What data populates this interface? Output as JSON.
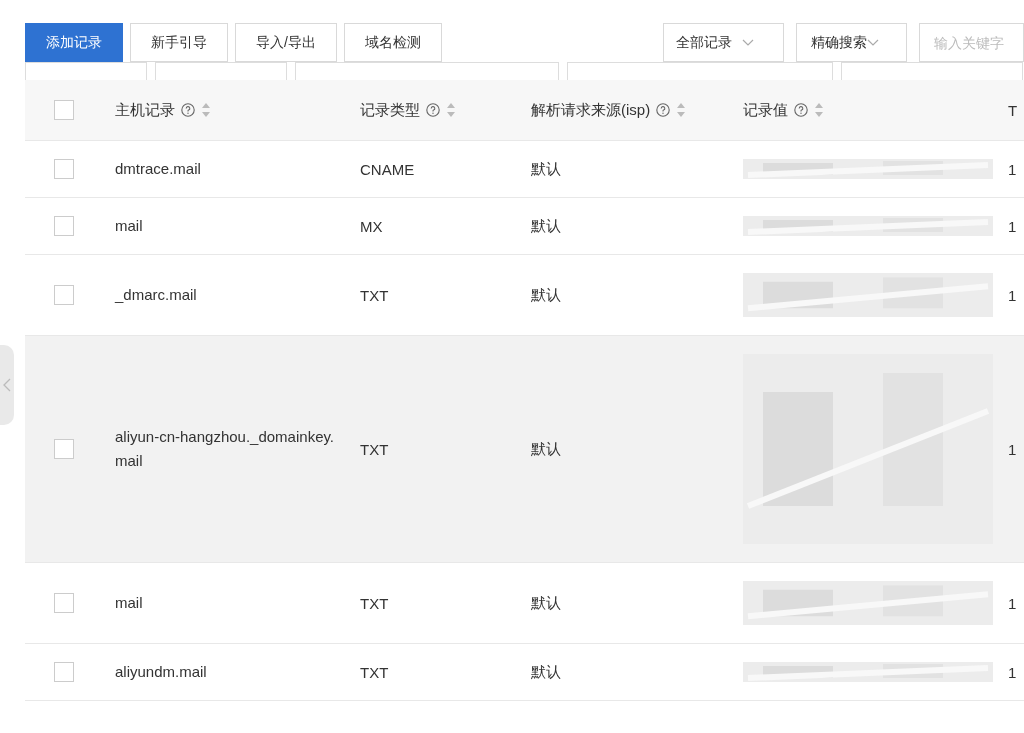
{
  "toolbar": {
    "primary_button": "添加记录",
    "buttons": [
      "新手引导",
      "导入/导出",
      "域名检测"
    ],
    "filter_dropdown": "全部记录",
    "search_mode_dropdown": "精确搜索",
    "search": {
      "placeholder": "输入关键字"
    }
  },
  "table": {
    "select_all_checked": false,
    "columns": [
      "主机记录",
      "记录类型",
      "解析请求来源(isp)",
      "记录值"
    ],
    "column_5": "T",
    "rows": [
      {
        "checked": false,
        "hovered": false,
        "host": "dmtrace.mail",
        "type": "CNAME",
        "isp": "默认",
        "column_5": "1"
      },
      {
        "checked": false,
        "hovered": false,
        "host": "mail",
        "type": "MX",
        "isp": "默认",
        "column_5": "1"
      },
      {
        "checked": false,
        "hovered": false,
        "host": "_dmarc.mail",
        "type": "TXT",
        "isp": "默认",
        "column_5": "1"
      },
      {
        "checked": false,
        "hovered": true,
        "host": "aliyun-cn-hangzhou._domainkey.mail",
        "type": "TXT",
        "isp": "默认",
        "column_5": "1"
      },
      {
        "checked": false,
        "hovered": false,
        "host": "mail",
        "type": "TXT",
        "isp": "默认",
        "column_5": "1"
      },
      {
        "checked": false,
        "hovered": false,
        "host": "aliyundm.mail",
        "type": "TXT",
        "isp": "默认",
        "column_5": "1"
      }
    ]
  }
}
